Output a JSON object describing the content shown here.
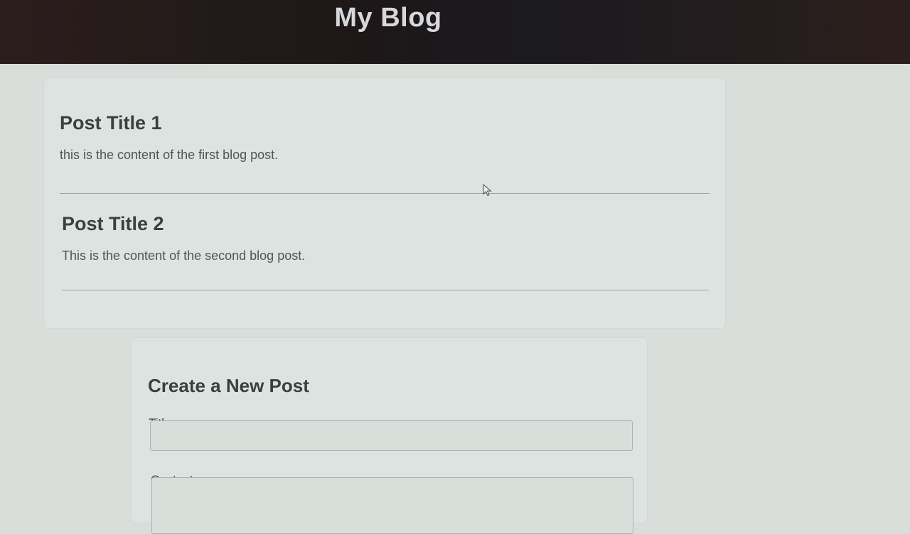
{
  "header": {
    "title": "My Blog"
  },
  "posts": [
    {
      "title": "Post Title 1",
      "content": "this is the content of the first blog post."
    },
    {
      "title": "Post Title 2",
      "content": "This is the content of the second blog post."
    }
  ],
  "new_post_form": {
    "heading": "Create a New Post",
    "title_label": "Title:",
    "title_value": "",
    "content_label": "Content:",
    "content_value": ""
  },
  "colors": {
    "header_background": "#1d1718",
    "header_text": "#d7d8dc",
    "page_background": "#d9dedb",
    "card_background": "#dde3e0"
  },
  "icons": {
    "pointer": "cursor-arrow-icon"
  }
}
